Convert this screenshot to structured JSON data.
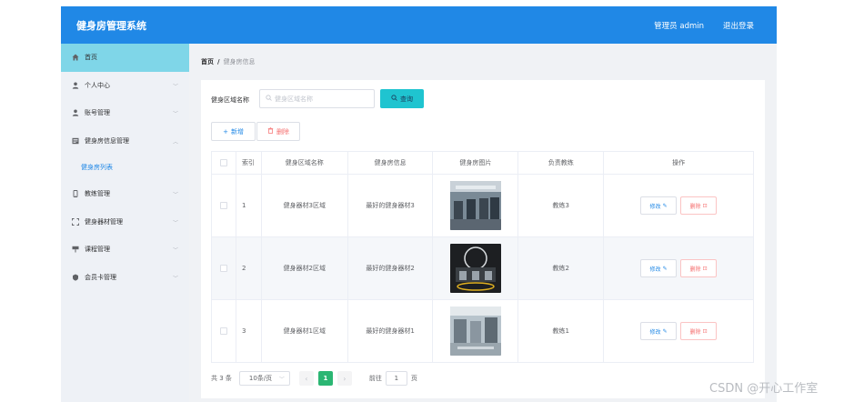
{
  "header": {
    "title": "健身房管理系统",
    "admin_label": "管理员 admin",
    "logout_label": "退出登录",
    "bg_color": "#2088e6"
  },
  "sidebar": {
    "items": [
      {
        "label": "首页",
        "icon": "home-icon",
        "active": true
      },
      {
        "label": "个人中心",
        "icon": "user-icon"
      },
      {
        "label": "账号管理",
        "icon": "user-icon"
      },
      {
        "label": "健身房信息管理",
        "icon": "info-icon",
        "expanded": true
      },
      {
        "label": "健身房列表",
        "icon": "none"
      },
      {
        "label": "教练管理",
        "icon": "phone-icon"
      },
      {
        "label": "健身器材管理",
        "icon": "frame-icon"
      },
      {
        "label": "课程管理",
        "icon": "flag-icon"
      },
      {
        "label": "会员卡管理",
        "icon": "badge-icon"
      }
    ]
  },
  "breadcrumb": {
    "home": "首页",
    "separator": "/",
    "current": "健身房信息"
  },
  "search": {
    "label": "健身区域名称",
    "placeholder": "健身区域名称",
    "button": "查询"
  },
  "actions": {
    "add": "新增",
    "delete": "删除"
  },
  "table": {
    "columns": [
      "",
      "索引",
      "健身区域名称",
      "健身房信息",
      "健身房图片",
      "负责教练",
      "操作"
    ],
    "rows": [
      {
        "index": "1",
        "area": "健身器材3区域",
        "info": "最好的健身器材3",
        "coach": "教练3"
      },
      {
        "index": "2",
        "area": "健身器材2区域",
        "info": "最好的健身器材2",
        "coach": "教练2"
      },
      {
        "index": "3",
        "area": "健身器材1区域",
        "info": "最好的健身器材1",
        "coach": "教练1"
      }
    ],
    "edit_label": "修改",
    "remove_label": "删除"
  },
  "pagination": {
    "total": "共 3 条",
    "page_size": "10条/页",
    "prev": "‹",
    "current_page": "1",
    "next": "›",
    "goto_label": "前往",
    "goto_value": "1",
    "page_unit": "页"
  },
  "watermark": "CSDN @开心工作室"
}
